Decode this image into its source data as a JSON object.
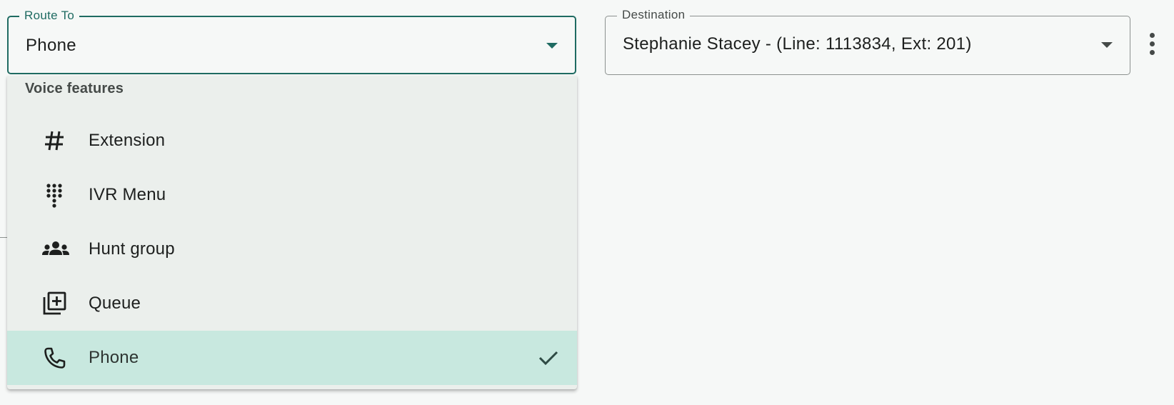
{
  "route_to": {
    "label": "Route To",
    "value": "Phone"
  },
  "destination": {
    "label": "Destination",
    "value": "Stephanie Stacey - (Line: 1113834, Ext: 201)"
  },
  "more_menu": {
    "icon": "more-vert-icon"
  },
  "menu": {
    "group_header": "Voice features",
    "items": [
      {
        "label": "Extension",
        "icon": "hash-icon",
        "selected": false
      },
      {
        "label": "IVR Menu",
        "icon": "dialpad-icon",
        "selected": false
      },
      {
        "label": "Hunt group",
        "icon": "groups-icon",
        "selected": false
      },
      {
        "label": "Queue",
        "icon": "library-add-icon",
        "selected": false
      },
      {
        "label": "Phone",
        "icon": "phone-icon",
        "selected": true
      }
    ],
    "selected_check_icon": "check-icon"
  },
  "colors": {
    "accent": "#1f6b62",
    "selected_bg": "#c8e8df",
    "menu_bg": "#ebefec",
    "page_bg": "#f6f8f7"
  }
}
